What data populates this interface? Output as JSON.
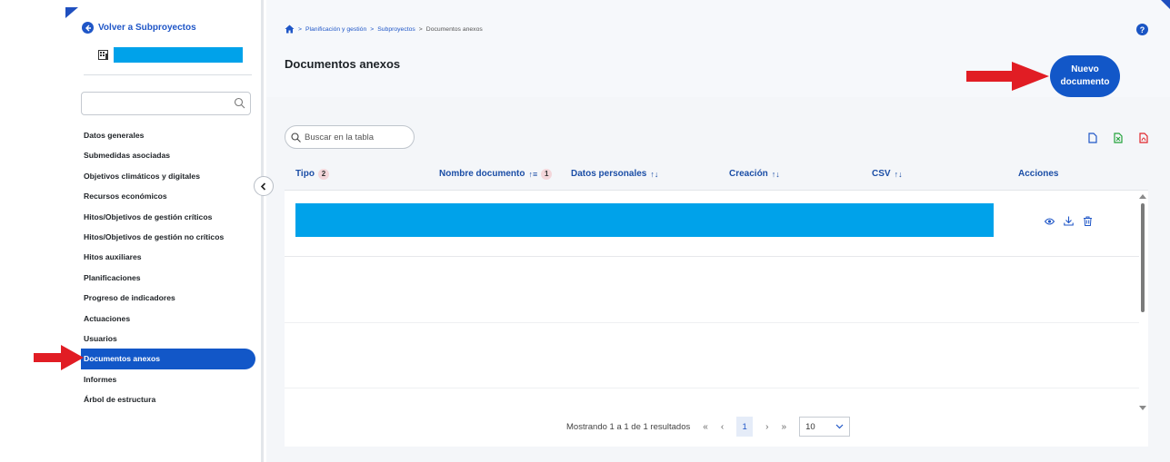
{
  "sidebar": {
    "back_label": "Volver a Subproyectos",
    "search_placeholder": "",
    "items": [
      {
        "label": "Datos generales",
        "active": false
      },
      {
        "label": "Submedidas asociadas",
        "active": false
      },
      {
        "label": "Objetivos climáticos y digitales",
        "active": false
      },
      {
        "label": "Recursos económicos",
        "active": false
      },
      {
        "label": "Hitos/Objetivos de gestión críticos",
        "active": false
      },
      {
        "label": "Hitos/Objetivos de gestión no críticos",
        "active": false
      },
      {
        "label": "Hitos auxiliares",
        "active": false
      },
      {
        "label": "Planificaciones",
        "active": false
      },
      {
        "label": "Progreso de indicadores",
        "active": false
      },
      {
        "label": "Actuaciones",
        "active": false
      },
      {
        "label": "Usuarios",
        "active": false
      },
      {
        "label": "Documentos anexos",
        "active": true
      },
      {
        "label": "Informes",
        "active": false
      },
      {
        "label": "Árbol de estructura",
        "active": false
      }
    ]
  },
  "breadcrumb": {
    "home_icon": "home-icon",
    "links": [
      "Planificación y gestión",
      "Subproyectos"
    ],
    "current": "Documentos anexos"
  },
  "header": {
    "title": "Documentos anexos",
    "help": "?",
    "new_button_line1": "Nuevo",
    "new_button_line2": "documento"
  },
  "table": {
    "search_placeholder": "Buscar en la tabla",
    "columns": [
      {
        "label": "Tipo",
        "badge": "2",
        "sort": ""
      },
      {
        "label": "Nombre documento",
        "badge": "1",
        "sort": "↑≡"
      },
      {
        "label": "Datos personales",
        "badge": "",
        "sort": "↑↓"
      },
      {
        "label": "Creación",
        "badge": "",
        "sort": "↑↓"
      },
      {
        "label": "CSV",
        "badge": "",
        "sort": "↑↓"
      },
      {
        "label": "Acciones",
        "badge": "",
        "sort": ""
      }
    ],
    "row_actions": [
      "eye-icon",
      "download-icon",
      "trash-icon"
    ]
  },
  "pagination": {
    "summary": "Mostrando 1 a 1 de 1 resultados",
    "first": "«",
    "prev": "‹",
    "current": "1",
    "next": "›",
    "last": "»",
    "page_size": "10"
  },
  "colors": {
    "primary": "#1257c8",
    "link": "#1f56c7",
    "redaction": "#00a2ea",
    "arrow": "#e11d24"
  }
}
